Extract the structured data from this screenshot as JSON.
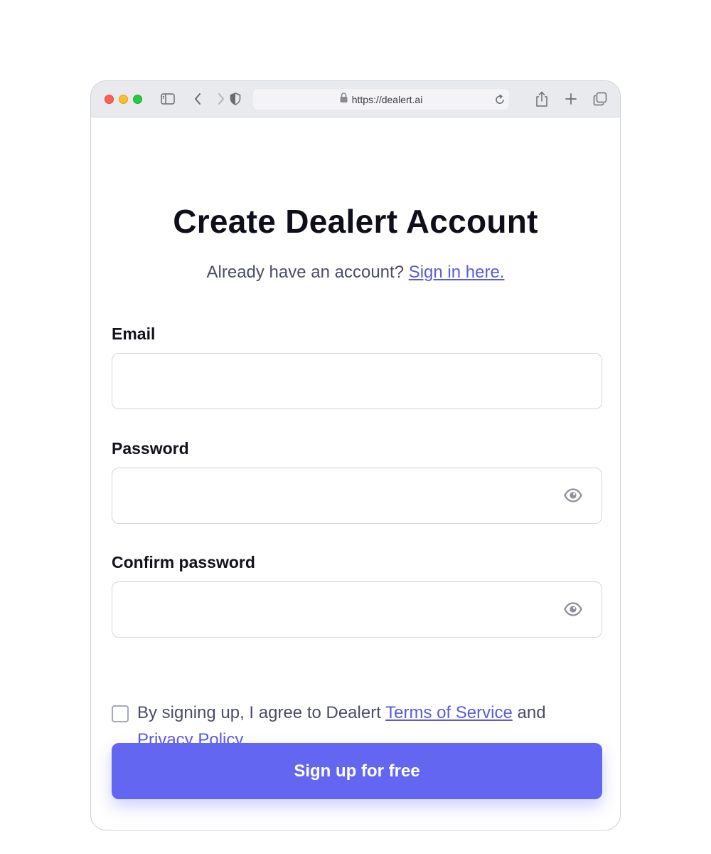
{
  "browser": {
    "url": "https://dealert.ai",
    "icons": [
      "sidebar-icon",
      "back-icon",
      "forward-icon",
      "shield-icon",
      "lock-icon",
      "reload-icon",
      "share-icon",
      "new-tab-icon",
      "tabs-overview-icon"
    ]
  },
  "form": {
    "title": "Create Dealert Account",
    "subtitle_prefix": "Already have an account?",
    "signin_link": "Sign in here.",
    "email_label": "Email",
    "email_value": "",
    "password_label": "Password",
    "password_value": "",
    "confirm_label": "Confirm password",
    "confirm_value": "",
    "agree_prefix": "By signing up, I agree to Dealert",
    "terms_link": "Terms of Service",
    "agree_and": "and",
    "privacy_link": "Privacy Policy",
    "agree_suffix": ".",
    "submit_label": "Sign up for free"
  },
  "colors": {
    "accent": "#6366f1",
    "link": "#5b5bdc",
    "title": "#0e0f1a",
    "muted_text": "#4b4d66"
  }
}
